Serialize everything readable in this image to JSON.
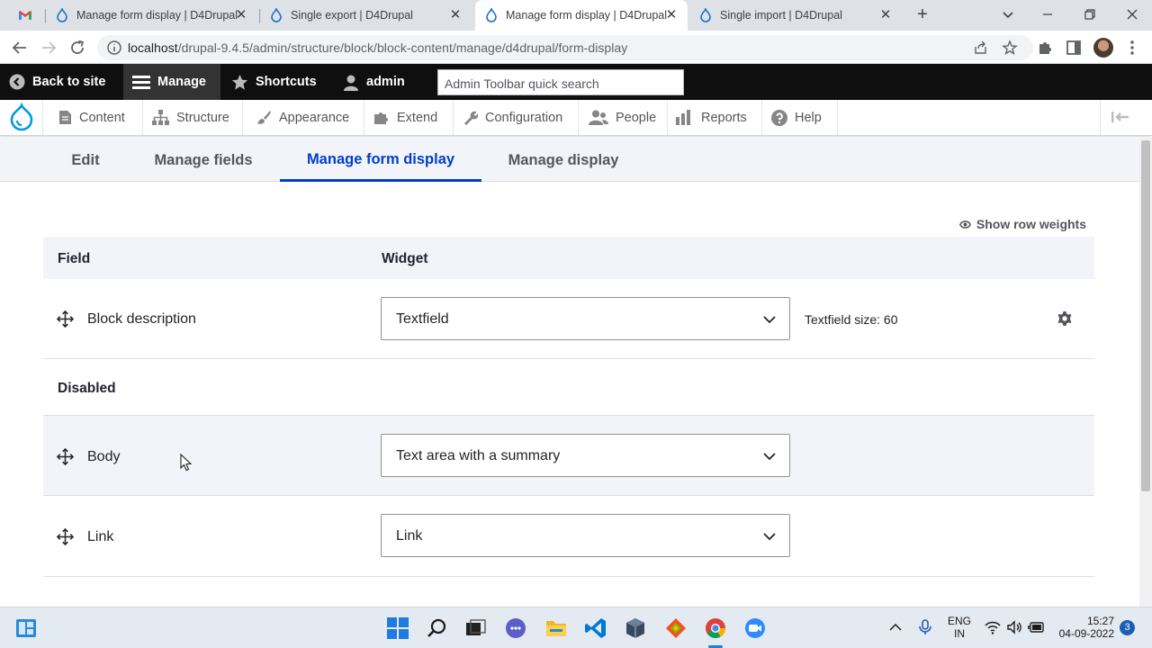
{
  "browser": {
    "tabs": [
      {
        "title": "",
        "icon": "gmail-icon"
      },
      {
        "title": "Manage form display | D4Drupal",
        "icon": "drupal-icon"
      },
      {
        "title": "Single export | D4Drupal",
        "icon": "drupal-icon"
      },
      {
        "title": "Manage form display | D4Drupal",
        "icon": "drupal-icon",
        "active": true
      },
      {
        "title": "Single import | D4Drupal",
        "icon": "drupal-icon"
      }
    ],
    "close_glyph": "✕",
    "new_tab_glyph": "+",
    "url_host": "localhost",
    "url_path": "/drupal-9.4.5/admin/structure/block/block-content/manage/d4drupal/form-display"
  },
  "admin_toolbar": {
    "back_to_site": "Back to site",
    "manage": "Manage",
    "shortcuts": "Shortcuts",
    "user": "admin",
    "search_placeholder": "Admin Toolbar quick search"
  },
  "admin_menu": {
    "items": [
      "Content",
      "Structure",
      "Appearance",
      "Extend",
      "Configuration",
      "People",
      "Reports",
      "Help"
    ]
  },
  "local_tabs": {
    "items": [
      "Edit",
      "Manage fields",
      "Manage form display",
      "Manage display"
    ],
    "active_index": 2
  },
  "show_row_weights": "Show row weights",
  "table": {
    "headers": {
      "field": "Field",
      "widget": "Widget"
    },
    "enabled_rows": [
      {
        "field": "Block description",
        "widget": "Textfield",
        "summary": "Textfield size: 60"
      }
    ],
    "disabled_label": "Disabled",
    "disabled_rows": [
      {
        "field": "Body",
        "widget": "Text area with a summary"
      },
      {
        "field": "Link",
        "widget": "Link"
      }
    ]
  },
  "taskbar": {
    "lang_line1": "ENG",
    "lang_line2": "IN",
    "time": "15:27",
    "date": "04-09-2022",
    "notifications": "3"
  },
  "colors": {
    "accent": "#003ecc",
    "toolbar_bg": "#0f0f0f",
    "tab_bar_bg": "#f3f4f9"
  }
}
